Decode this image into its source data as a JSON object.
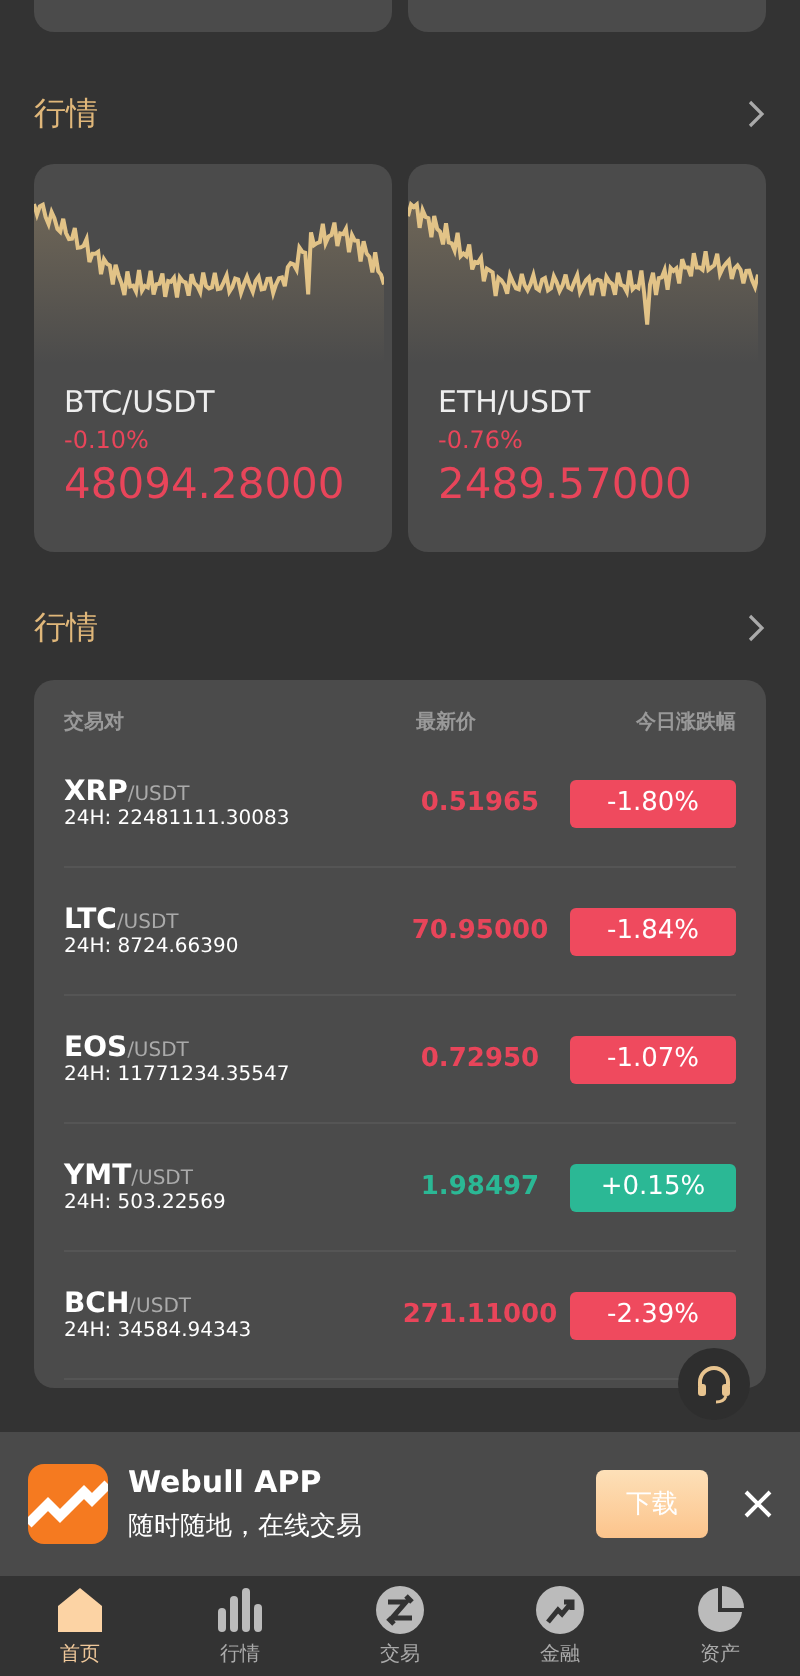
{
  "top_cards": [
    {
      "kind": "card"
    },
    {
      "kind": "card"
    }
  ],
  "ticker_section": {
    "title": "行情",
    "cards": [
      {
        "pair": "BTC/USDT",
        "change": "-0.10%",
        "price": "48094.28000",
        "kind": "down"
      },
      {
        "pair": "ETH/USDT",
        "change": "-0.76%",
        "price": "2489.57000",
        "kind": "down"
      }
    ]
  },
  "market_section": {
    "title": "行情",
    "columns": [
      "交易对",
      "最新价",
      "今日涨跌幅"
    ],
    "rows": [
      {
        "base": "XRP",
        "quote": "/USDT",
        "volume": "24H: 22481111.30083",
        "price": "0.51965",
        "change": "-1.80%",
        "kind": "down"
      },
      {
        "base": "LTC",
        "quote": "/USDT",
        "volume": "24H: 8724.66390",
        "price": "70.95000",
        "change": "-1.84%",
        "kind": "down"
      },
      {
        "base": "EOS",
        "quote": "/USDT",
        "volume": "24H: 11771234.35547",
        "price": "0.72950",
        "change": "-1.07%",
        "kind": "down"
      },
      {
        "base": "YMT",
        "quote": "/USDT",
        "volume": "24H: 503.22569",
        "price": "1.98497",
        "change": "+0.15%",
        "kind": "up"
      },
      {
        "base": "BCH",
        "quote": "/USDT",
        "volume": "24H: 34584.94343",
        "price": "271.11000",
        "change": "-2.39%",
        "kind": "down"
      }
    ]
  },
  "app_banner": {
    "title": "Webull APP",
    "subtitle": "随时随地，在线交易",
    "button": "下载"
  },
  "tab_bar": [
    {
      "label": "首页",
      "kind": "home",
      "selected": true
    },
    {
      "label": "行情",
      "kind": "bars",
      "selected": false
    },
    {
      "label": "交易",
      "kind": "trade",
      "selected": false
    },
    {
      "label": "金融",
      "kind": "growth",
      "selected": false
    },
    {
      "label": "资产",
      "kind": "pie",
      "selected": false
    }
  ]
}
